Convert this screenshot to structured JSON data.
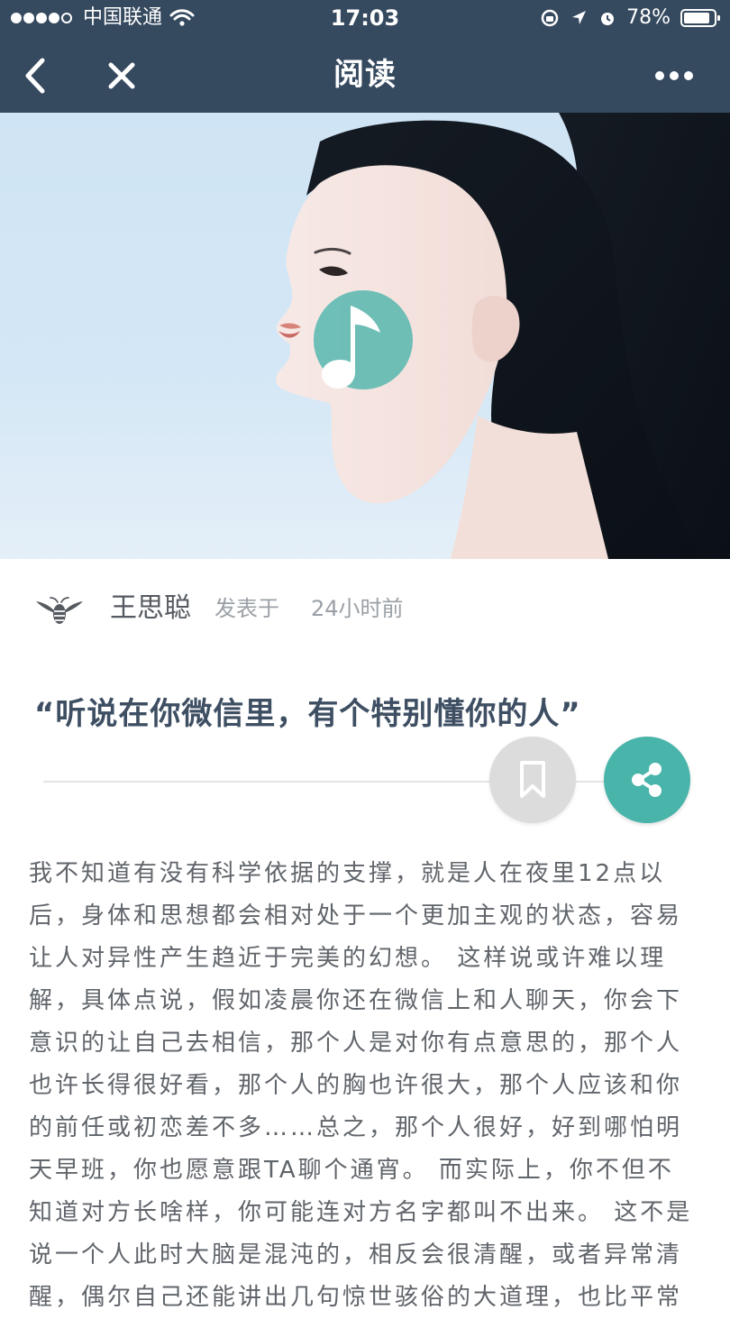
{
  "status_bar": {
    "carrier": "中国联通",
    "time": "17:03",
    "battery": "78%"
  },
  "nav": {
    "title": "阅读",
    "back_icon": "chevron-left-icon",
    "close_icon": "close-icon",
    "more_icon": "more-icon"
  },
  "hero": {
    "badge_icon": "music-note-icon",
    "accent": "#48b4aa"
  },
  "author": {
    "name": "王思聪",
    "posted_label": "发表于",
    "posted_time": "24小时前"
  },
  "article": {
    "title": "“听说在你微信里，有个特别懂你的人”",
    "body_lines": [
      "我不知道有没有科学依据的支撑，就是人在夜里12点以",
      "后，身体和思想都会相对处于一个更加主观的状态，容易",
      "让人对异性产生趋近于完美的幻想。 这样说或许难以理",
      "解，具体点说，假如凌晨你还在微信上和人聊天，你会下",
      "意识的让自己去相信，那个人是对你有点意思的，那个人",
      "也许长得很好看，那个人的胸也许很大，那个人应该和你",
      "的前任或初恋差不多……总之，那个人很好，好到哪怕明",
      "天早班，你也愿意跟TA聊个通宵。 而实际上，你不但不",
      "知道对方长啥样，你可能连对方名字都叫不出来。 这不是",
      "说一个人此时大脑是混沌的，相反会很清醒，或者异常清",
      "醒，偶尔自己还能讲出几句惊世骇俗的大道理，也比平常"
    ]
  },
  "actions": {
    "bookmark_icon": "bookmark-icon",
    "share_icon": "share-icon"
  }
}
